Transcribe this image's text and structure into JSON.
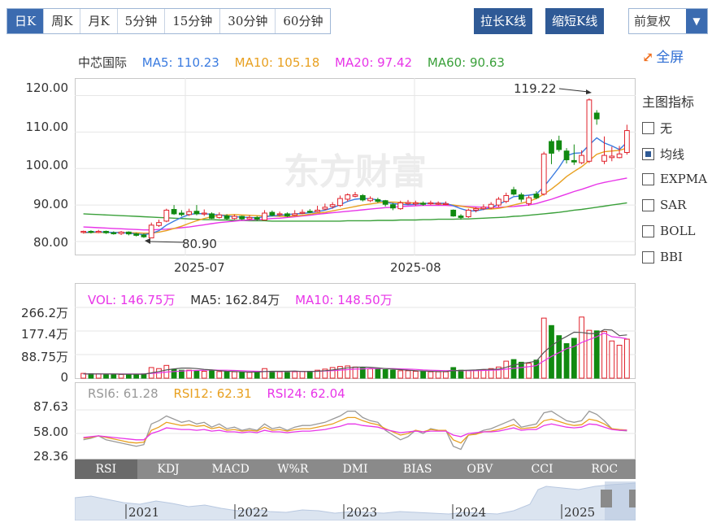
{
  "period_tabs": [
    "日K",
    "周K",
    "月K",
    "5分钟",
    "15分钟",
    "30分钟",
    "60分钟"
  ],
  "buttons": {
    "stretch": "拉长K线",
    "shrink": "缩短K线"
  },
  "adjust_select": "前复权",
  "fullscreen": "全屏",
  "price_legend": {
    "name": "中芯国际",
    "ma5": "MA5: 110.23",
    "ma10": "MA10: 105.18",
    "ma20": "MA20: 97.42",
    "ma60": "MA60: 90.63"
  },
  "price_axis": [
    "120.00",
    "110.00",
    "100.00",
    "90.00",
    "80.00"
  ],
  "date_axis": [
    "2025-07",
    "2025-08"
  ],
  "annotations": {
    "high": "119.22",
    "low": "80.90"
  },
  "watermark": "东方财富",
  "indicator_panel": {
    "title": "主图指标",
    "items": [
      {
        "label": "无",
        "checked": false
      },
      {
        "label": "均线",
        "checked": true
      },
      {
        "label": "EXPMA",
        "checked": false
      },
      {
        "label": "SAR",
        "checked": false
      },
      {
        "label": "BOLL",
        "checked": false
      },
      {
        "label": "BBI",
        "checked": false
      }
    ]
  },
  "volume_legend": {
    "vol": "VOL: 146.75万",
    "ma5": "MA5: 162.84万",
    "ma10": "MA10: 148.50万"
  },
  "volume_axis": [
    "266.2万",
    "177.4万",
    "88.75万",
    "0"
  ],
  "rsi_legend": {
    "rsi6": "RSI6: 61.28",
    "rsi12": "RSI12: 62.31",
    "rsi24": "RSI24: 62.04"
  },
  "rsi_axis": [
    "87.63",
    "58.00",
    "28.36"
  ],
  "indicator_tabs": [
    "RSI",
    "KDJ",
    "MACD",
    "W%R",
    "DMI",
    "BIAS",
    "OBV",
    "CCI",
    "ROC"
  ],
  "timeline_years": [
    "2021",
    "2022",
    "2023",
    "2024",
    "2025"
  ],
  "colors": {
    "up": "#e0202a",
    "down": "#118a11",
    "ma5": "#3a7be0",
    "ma10": "#e8a020",
    "ma20": "#e835e8",
    "ma60": "#3aa03a",
    "accent": "#2f5a96"
  },
  "chart_data": {
    "type": "candlestick",
    "ylim": [
      78,
      123
    ],
    "candles": [
      [
        82.5,
        82.8,
        83.0,
        82.2,
        0
      ],
      [
        82.8,
        82.5,
        83.1,
        82.2,
        1
      ],
      [
        82.5,
        82.8,
        83.2,
        82.3,
        0
      ],
      [
        82.8,
        82.4,
        83.0,
        82.1,
        1
      ],
      [
        82.4,
        82.2,
        82.8,
        81.9,
        1
      ],
      [
        82.2,
        82.6,
        82.9,
        81.8,
        0
      ],
      [
        82.6,
        82.1,
        82.8,
        81.7,
        1
      ],
      [
        82.1,
        81.7,
        82.4,
        81.4,
        1
      ],
      [
        81.8,
        81.3,
        82.2,
        81.0,
        1
      ],
      [
        81.0,
        84.5,
        85.2,
        80.9,
        0
      ],
      [
        84.4,
        85.2,
        86.0,
        84.0,
        0
      ],
      [
        85.6,
        88.6,
        89.0,
        85.3,
        0
      ],
      [
        88.8,
        87.6,
        90.0,
        87.3,
        1
      ],
      [
        87.8,
        87.4,
        88.6,
        86.9,
        1
      ],
      [
        87.4,
        88.2,
        89.0,
        87.0,
        0
      ],
      [
        88.3,
        87.6,
        90.0,
        87.2,
        1
      ],
      [
        87.6,
        87.8,
        88.8,
        87.0,
        0
      ],
      [
        87.6,
        86.4,
        88.0,
        86.2,
        1
      ],
      [
        86.6,
        87.3,
        88.0,
        86.3,
        0
      ],
      [
        87.0,
        86.3,
        87.5,
        85.8,
        1
      ],
      [
        86.3,
        86.9,
        87.4,
        86.0,
        0
      ],
      [
        86.9,
        86.2,
        87.1,
        85.9,
        1
      ],
      [
        86.2,
        86.6,
        87.2,
        86.0,
        0
      ],
      [
        86.6,
        86.1,
        87.0,
        85.7,
        1
      ],
      [
        85.9,
        87.8,
        88.6,
        85.8,
        0
      ],
      [
        88.0,
        87.2,
        88.5,
        86.9,
        1
      ],
      [
        87.4,
        87.6,
        88.2,
        87.0,
        0
      ],
      [
        87.6,
        87.0,
        88.0,
        86.7,
        1
      ],
      [
        87.2,
        87.6,
        88.6,
        87.0,
        0
      ],
      [
        87.8,
        88.0,
        88.8,
        87.5,
        0
      ],
      [
        88.3,
        88.2,
        88.9,
        87.8,
        1
      ],
      [
        88.2,
        88.6,
        89.8,
        88.0,
        0
      ],
      [
        88.9,
        89.4,
        90.4,
        88.6,
        0
      ],
      [
        89.6,
        90.1,
        90.8,
        89.0,
        0
      ],
      [
        89.9,
        91.8,
        92.6,
        89.5,
        0
      ],
      [
        91.6,
        92.8,
        93.2,
        91.0,
        0
      ],
      [
        92.4,
        92.8,
        93.6,
        92.1,
        0
      ],
      [
        92.6,
        91.4,
        93.0,
        91.0,
        1
      ],
      [
        91.8,
        91.2,
        92.4,
        90.8,
        0
      ],
      [
        91.5,
        91.0,
        92.0,
        90.6,
        1
      ],
      [
        91.2,
        90.2,
        91.4,
        89.6,
        1
      ],
      [
        90.1,
        89.2,
        90.6,
        88.6,
        1
      ],
      [
        89.0,
        90.6,
        91.2,
        88.7,
        0
      ],
      [
        90.7,
        90.4,
        91.4,
        90.0,
        0
      ],
      [
        90.3,
        90.6,
        91.2,
        89.8,
        0
      ],
      [
        90.5,
        90.2,
        91.0,
        89.8,
        1
      ],
      [
        90.4,
        90.6,
        91.2,
        90.0,
        0
      ],
      [
        90.5,
        90.4,
        91.0,
        90.0,
        0
      ],
      [
        90.4,
        90.3,
        91.0,
        90.0,
        0
      ],
      [
        88.6,
        87.0,
        88.8,
        86.8,
        1
      ],
      [
        87.0,
        86.6,
        87.5,
        86.0,
        1
      ],
      [
        86.8,
        88.6,
        89.0,
        86.5,
        0
      ],
      [
        88.6,
        89.0,
        89.4,
        88.0,
        0
      ],
      [
        89.0,
        89.4,
        90.2,
        88.6,
        0
      ],
      [
        89.2,
        90.2,
        90.8,
        88.9,
        0
      ],
      [
        90.0,
        91.6,
        92.2,
        89.5,
        0
      ],
      [
        91.0,
        92.6,
        93.4,
        90.5,
        0
      ],
      [
        93.0,
        94.2,
        95.0,
        92.6,
        1
      ],
      [
        92.8,
        91.6,
        93.4,
        90.8,
        1
      ],
      [
        90.4,
        92.0,
        92.6,
        89.8,
        0
      ],
      [
        92.0,
        93.0,
        93.8,
        91.6,
        1
      ],
      [
        93.0,
        104.0,
        104.6,
        92.6,
        0
      ],
      [
        104.2,
        107.4,
        108.0,
        101.2,
        1
      ],
      [
        107.6,
        105.2,
        109.0,
        104.6,
        1
      ],
      [
        104.8,
        102.4,
        105.6,
        101.4,
        1
      ],
      [
        102.2,
        101.8,
        106.6,
        101.0,
        1
      ],
      [
        101.6,
        103.6,
        105.0,
        101.2,
        0
      ],
      [
        102.0,
        118.8,
        119.2,
        101.5,
        0
      ],
      [
        115.2,
        113.6,
        116.0,
        112.0,
        1
      ],
      [
        102.0,
        103.6,
        108.8,
        101.2,
        0
      ],
      [
        103.0,
        103.4,
        106.0,
        102.0,
        0
      ],
      [
        103.0,
        104.0,
        106.2,
        102.8,
        0
      ],
      [
        104.4,
        110.4,
        112.0,
        103.8,
        0
      ]
    ],
    "ma5": [
      82.5,
      82.6,
      82.7,
      82.6,
      82.5,
      82.4,
      82.3,
      82.1,
      81.9,
      82.2,
      83.0,
      84.5,
      85.6,
      86.6,
      87.4,
      87.7,
      87.6,
      87.5,
      87.3,
      87.0,
      86.8,
      86.7,
      86.6,
      86.5,
      86.8,
      87.0,
      87.2,
      87.4,
      87.6,
      87.7,
      87.9,
      88.2,
      88.6,
      89.2,
      90.1,
      91.0,
      91.6,
      91.8,
      91.7,
      91.4,
      90.8,
      90.4,
      90.2,
      90.1,
      90.2,
      90.4,
      90.5,
      90.5,
      90.5,
      89.8,
      89.0,
      88.4,
      88.4,
      88.8,
      89.3,
      90.2,
      91.2,
      92.3,
      92.5,
      92.7,
      93.0,
      95.0,
      97.6,
      100.3,
      103.5,
      104.2,
      104.3,
      106.5,
      108.4,
      107.0,
      106.2,
      105.2,
      107.2
    ],
    "ma10": [
      82.4,
      82.5,
      82.5,
      82.5,
      82.5,
      82.5,
      82.4,
      82.4,
      82.3,
      82.3,
      82.6,
      83.0,
      83.6,
      84.2,
      85.0,
      85.7,
      86.3,
      86.8,
      87.2,
      87.3,
      87.4,
      87.3,
      87.2,
      87.1,
      87.0,
      87.0,
      86.9,
      86.9,
      87.0,
      87.2,
      87.5,
      87.8,
      88.0,
      88.4,
      88.8,
      89.2,
      89.6,
      90.0,
      90.3,
      90.6,
      90.8,
      90.8,
      90.7,
      90.6,
      90.6,
      90.5,
      90.4,
      90.3,
      90.2,
      90.0,
      89.7,
      89.4,
      89.1,
      88.9,
      88.9,
      89.1,
      89.5,
      90.0,
      90.5,
      91.0,
      91.8,
      93.0,
      94.4,
      96.0,
      97.8,
      99.2,
      100.5,
      102.2,
      103.9,
      104.6,
      104.8,
      105.0,
      105.6
    ],
    "ma20": [
      84.0,
      83.9,
      83.8,
      83.7,
      83.6,
      83.5,
      83.4,
      83.3,
      83.2,
      83.2,
      83.3,
      83.4,
      83.6,
      83.8,
      84.0,
      84.3,
      84.6,
      84.9,
      85.2,
      85.4,
      85.6,
      85.8,
      85.9,
      86.0,
      86.1,
      86.3,
      86.4,
      86.6,
      86.8,
      87.0,
      87.2,
      87.5,
      87.7,
      87.9,
      88.1,
      88.3,
      88.5,
      88.7,
      88.9,
      89.1,
      89.3,
      89.4,
      89.6,
      89.7,
      89.8,
      89.9,
      89.9,
      89.9,
      89.9,
      89.8,
      89.7,
      89.6,
      89.5,
      89.4,
      89.4,
      89.4,
      89.5,
      89.6,
      89.8,
      90.0,
      90.4,
      91.0,
      91.6,
      92.3,
      93.0,
      93.7,
      94.3,
      95.0,
      95.7,
      96.2,
      96.6,
      97.0,
      97.4
    ],
    "ma60": [
      87.6,
      87.5,
      87.4,
      87.3,
      87.2,
      87.1,
      87.0,
      86.9,
      86.8,
      86.7,
      86.6,
      86.5,
      86.4,
      86.3,
      86.2,
      86.1,
      86.0,
      86.0,
      85.9,
      85.9,
      85.8,
      85.8,
      85.7,
      85.7,
      85.7,
      85.6,
      85.6,
      85.6,
      85.6,
      85.6,
      85.6,
      85.6,
      85.6,
      85.6,
      85.6,
      85.7,
      85.7,
      85.7,
      85.7,
      85.8,
      85.8,
      85.8,
      85.9,
      85.9,
      85.9,
      86.0,
      86.0,
      86.1,
      86.1,
      86.1,
      86.2,
      86.2,
      86.3,
      86.4,
      86.5,
      86.6,
      86.7,
      86.9,
      87.0,
      87.2,
      87.4,
      87.6,
      87.8,
      88.0,
      88.3,
      88.6,
      88.8,
      89.1,
      89.4,
      89.7,
      90.0,
      90.3,
      90.6
    ],
    "volume": {
      "ylim": [
        0,
        266.2
      ],
      "values": [
        18,
        17,
        16,
        15,
        15,
        14,
        14,
        15,
        16,
        40,
        36,
        48,
        34,
        30,
        30,
        28,
        26,
        28,
        25,
        24,
        24,
        23,
        22,
        22,
        36,
        26,
        24,
        22,
        24,
        26,
        26,
        30,
        34,
        40,
        44,
        46,
        42,
        38,
        35,
        34,
        32,
        30,
        28,
        28,
        26,
        25,
        24,
        24,
        24,
        40,
        30,
        28,
        30,
        32,
        36,
        42,
        64,
        70,
        60,
        56,
        68,
        226,
        198,
        160,
        130,
        150,
        230,
        180,
        178,
        176,
        140,
        124,
        146.75
      ],
      "ma5": [
        16,
        16,
        16,
        16,
        16,
        15,
        15,
        15,
        15,
        20,
        25,
        31,
        35,
        38,
        38,
        36,
        33,
        31,
        28,
        26,
        25,
        24,
        23,
        23,
        25,
        26,
        26,
        26,
        27,
        25,
        25,
        26,
        28,
        31,
        35,
        39,
        41,
        42,
        41,
        39,
        36,
        34,
        32,
        30,
        28,
        27,
        26,
        25,
        25,
        28,
        29,
        30,
        31,
        33,
        33,
        34,
        41,
        49,
        55,
        59,
        64,
        97,
        122,
        142,
        157,
        173,
        172,
        168,
        168,
        183,
        181,
        160,
        162.84
      ],
      "ma10": [
        16,
        16,
        16,
        16,
        16,
        16,
        16,
        16,
        16,
        18,
        20,
        23,
        25,
        27,
        28,
        29,
        30,
        31,
        30,
        30,
        29,
        28,
        27,
        26,
        25,
        25,
        25,
        25,
        26,
        25,
        25,
        26,
        27,
        28,
        30,
        32,
        34,
        35,
        36,
        36,
        36,
        36,
        35,
        34,
        33,
        31,
        30,
        29,
        28,
        29,
        28,
        28,
        28,
        29,
        30,
        31,
        34,
        37,
        40,
        43,
        47,
        65,
        82,
        96,
        111,
        119,
        134,
        145,
        156,
        170,
        156,
        153,
        148.5
      ]
    },
    "rsi": {
      "ylim": [
        28.36,
        87.63
      ],
      "rsi6": [
        50,
        52,
        55,
        50,
        48,
        46,
        44,
        42,
        44,
        70,
        74,
        80,
        76,
        72,
        74,
        70,
        72,
        66,
        70,
        64,
        66,
        62,
        64,
        62,
        70,
        64,
        66,
        62,
        66,
        68,
        68,
        70,
        72,
        76,
        80,
        86,
        86,
        78,
        74,
        72,
        62,
        56,
        50,
        54,
        62,
        58,
        64,
        62,
        62,
        42,
        38,
        56,
        58,
        62,
        64,
        68,
        72,
        76,
        66,
        68,
        70,
        84,
        86,
        80,
        74,
        72,
        74,
        86,
        82,
        74,
        64,
        62,
        61.28
      ],
      "rsi12": [
        52,
        53,
        55,
        53,
        51,
        49,
        47,
        46,
        47,
        62,
        66,
        72,
        70,
        68,
        69,
        67,
        68,
        64,
        66,
        62,
        63,
        61,
        62,
        61,
        66,
        62,
        63,
        61,
        63,
        64,
        64,
        66,
        68,
        70,
        74,
        78,
        78,
        74,
        71,
        69,
        64,
        60,
        56,
        58,
        62,
        60,
        63,
        62,
        62,
        50,
        46,
        56,
        57,
        60,
        61,
        63,
        66,
        69,
        64,
        65,
        66,
        74,
        76,
        73,
        70,
        68,
        69,
        76,
        74,
        70,
        64,
        63,
        62.31
      ],
      "rsi24": [
        53,
        54,
        55,
        54,
        53,
        52,
        51,
        50,
        50,
        58,
        61,
        65,
        64,
        63,
        63,
        62,
        63,
        61,
        62,
        60,
        60,
        59,
        60,
        59,
        62,
        60,
        60,
        59,
        60,
        61,
        61,
        62,
        63,
        65,
        67,
        70,
        70,
        68,
        67,
        66,
        63,
        61,
        59,
        60,
        61,
        60,
        61,
        61,
        61,
        56,
        54,
        58,
        59,
        60,
        60,
        61,
        63,
        65,
        62,
        63,
        63,
        68,
        70,
        68,
        66,
        65,
        66,
        70,
        69,
        66,
        63,
        62,
        62.04
      ]
    }
  }
}
